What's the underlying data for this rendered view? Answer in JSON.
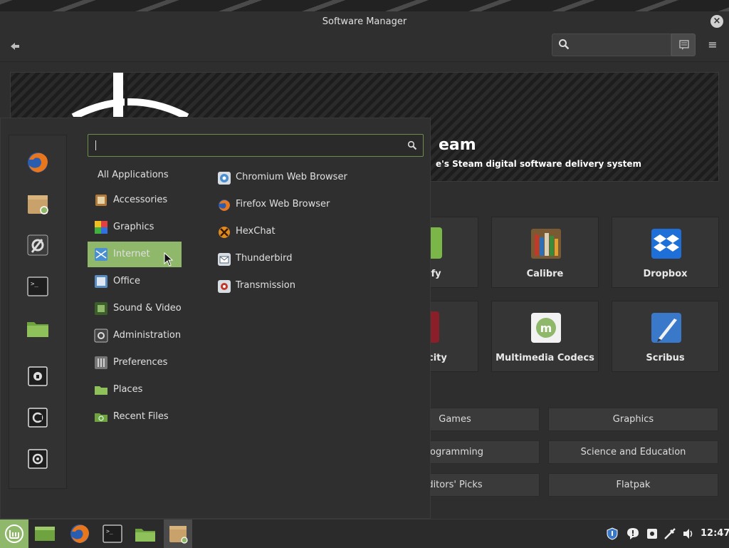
{
  "window": {
    "title": "Software Manager",
    "close_label": "×"
  },
  "toolbar": {
    "back_label": "🡰",
    "menu_label": "≡"
  },
  "banner": {
    "title": "eam",
    "subtitle": "e's Steam digital software delivery system"
  },
  "cards": [
    {
      "label": "ify",
      "icon": "spotify-icon"
    },
    {
      "label": "Calibre",
      "icon": "calibre-icon"
    },
    {
      "label": "Dropbox",
      "icon": "dropbox-icon"
    },
    {
      "label": "city",
      "icon": "audacity-icon"
    },
    {
      "label": "Multimedia Codecs",
      "icon": "mint-codecs-icon"
    },
    {
      "label": "Scribus",
      "icon": "scribus-icon"
    }
  ],
  "categories_buttons": [
    "Games",
    "Graphics",
    "rogramming",
    "Science and Education",
    "ditors' Picks",
    "Flatpak"
  ],
  "menu": {
    "search_value": "",
    "categories": [
      {
        "label": "All Applications",
        "icon": "",
        "selected": false
      },
      {
        "label": "Accessories",
        "icon": "accessories-icon",
        "selected": false
      },
      {
        "label": "Graphics",
        "icon": "graphics-icon",
        "selected": false
      },
      {
        "label": "Internet",
        "icon": "internet-icon",
        "selected": true
      },
      {
        "label": "Office",
        "icon": "office-icon",
        "selected": false
      },
      {
        "label": "Sound & Video",
        "icon": "sound-video-icon",
        "selected": false
      },
      {
        "label": "Administration",
        "icon": "administration-icon",
        "selected": false
      },
      {
        "label": "Preferences",
        "icon": "preferences-icon",
        "selected": false
      },
      {
        "label": "Places",
        "icon": "places-folder-icon",
        "selected": false
      },
      {
        "label": "Recent Files",
        "icon": "recent-files-icon",
        "selected": false
      }
    ],
    "apps": [
      {
        "label": "Chromium Web Browser",
        "icon": "chromium-icon"
      },
      {
        "label": "Firefox Web Browser",
        "icon": "firefox-icon"
      },
      {
        "label": "HexChat",
        "icon": "hexchat-icon"
      },
      {
        "label": "Thunderbird",
        "icon": "thunderbird-icon"
      },
      {
        "label": "Transmission",
        "icon": "transmission-icon"
      }
    ],
    "favorites": [
      "firefox-icon",
      "software-manager-icon",
      "system-settings-icon",
      "terminal-icon",
      "files-icon",
      "lock-screen-icon",
      "logout-icon",
      "shutdown-icon"
    ]
  },
  "taskbar": {
    "items": [
      "mint-menu-icon",
      "show-desktop-icon",
      "firefox-icon",
      "terminal-icon",
      "files-icon",
      "software-manager-icon"
    ],
    "tray": [
      "update-shield-icon",
      "notifications-icon",
      "display-icon",
      "network-icon",
      "volume-icon"
    ],
    "clock": "12:47"
  },
  "colors": {
    "accent": "#8fb86b",
    "background": "#2e2e2e"
  }
}
